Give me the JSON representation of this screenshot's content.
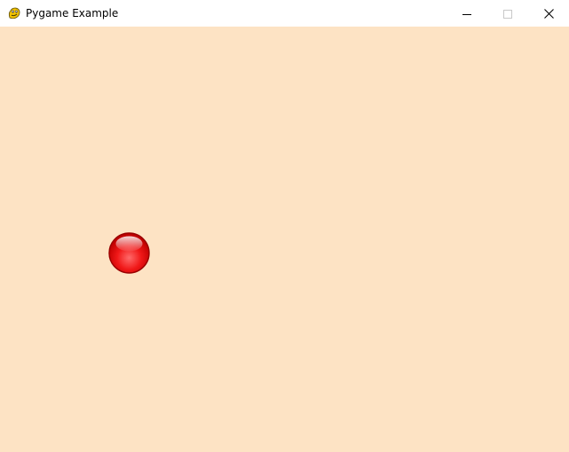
{
  "window": {
    "title": "Pygame Example",
    "app_icon": "pygame-snake-icon",
    "controls": {
      "minimize_icon": "minimize-icon",
      "maximize_icon": "maximize-icon",
      "close_icon": "close-icon"
    }
  },
  "game": {
    "background_color": "#FDE3C4",
    "ball": {
      "icon": "red-ball-icon",
      "color": "#F01010"
    }
  }
}
